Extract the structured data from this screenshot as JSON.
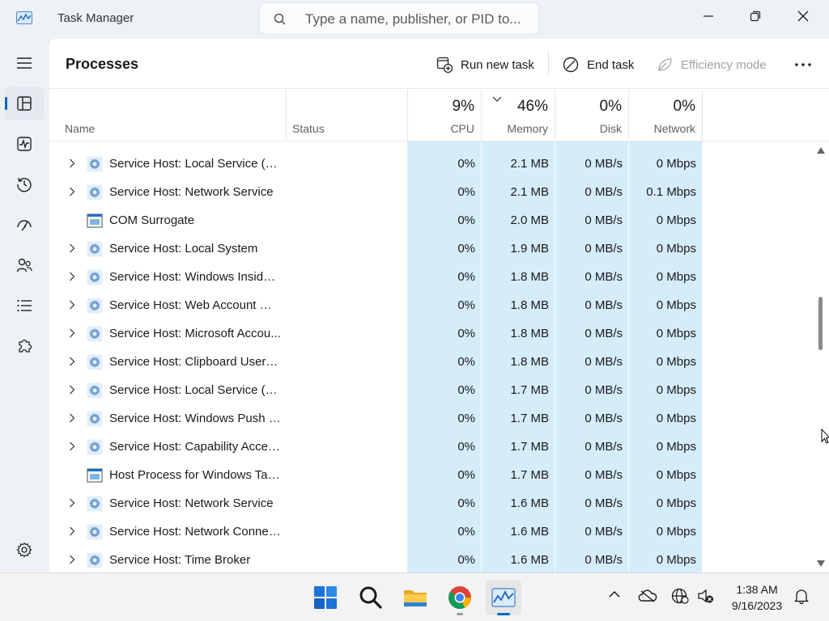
{
  "window": {
    "title": "Task Manager",
    "search_placeholder": "Type a name, publisher, or PID to..."
  },
  "toolbar": {
    "title": "Processes",
    "run_new_task": "Run new task",
    "end_task": "End task",
    "efficiency_mode": "Efficiency mode"
  },
  "columns": {
    "name": "Name",
    "status": "Status",
    "cpu": {
      "value": "9%",
      "label": "CPU"
    },
    "memory": {
      "value": "46%",
      "label": "Memory"
    },
    "disk": {
      "value": "0%",
      "label": "Disk"
    },
    "network": {
      "value": "0%",
      "label": "Network"
    }
  },
  "rows": [
    {
      "name": "Service Host: Local Service (N...",
      "cpu": "0%",
      "memory": "2.1 MB",
      "disk": "0 MB/s",
      "network": "0 Mbps",
      "expandable": true,
      "icon": "gear-icon"
    },
    {
      "name": "Service Host: Network Service",
      "cpu": "0%",
      "memory": "2.1 MB",
      "disk": "0 MB/s",
      "network": "0.1 Mbps",
      "expandable": true,
      "icon": "gear-icon"
    },
    {
      "name": "COM Surrogate",
      "cpu": "0%",
      "memory": "2.0 MB",
      "disk": "0 MB/s",
      "network": "0 Mbps",
      "expandable": false,
      "icon": "window-app-icon"
    },
    {
      "name": "Service Host: Local System",
      "cpu": "0%",
      "memory": "1.9 MB",
      "disk": "0 MB/s",
      "network": "0 Mbps",
      "expandable": true,
      "icon": "gear-icon"
    },
    {
      "name": "Service Host: Windows Insider ...",
      "cpu": "0%",
      "memory": "1.8 MB",
      "disk": "0 MB/s",
      "network": "0 Mbps",
      "expandable": true,
      "icon": "gear-icon"
    },
    {
      "name": "Service Host: Web Account Ma...",
      "cpu": "0%",
      "memory": "1.8 MB",
      "disk": "0 MB/s",
      "network": "0 Mbps",
      "expandable": true,
      "icon": "gear-icon"
    },
    {
      "name": "Service Host: Microsoft Accou...",
      "cpu": "0%",
      "memory": "1.8 MB",
      "disk": "0 MB/s",
      "network": "0 Mbps",
      "expandable": true,
      "icon": "gear-icon"
    },
    {
      "name": "Service Host: Clipboard User S...",
      "cpu": "0%",
      "memory": "1.8 MB",
      "disk": "0 MB/s",
      "network": "0 Mbps",
      "expandable": true,
      "icon": "gear-icon"
    },
    {
      "name": "Service Host: Local Service (N...",
      "cpu": "0%",
      "memory": "1.7 MB",
      "disk": "0 MB/s",
      "network": "0 Mbps",
      "expandable": true,
      "icon": "gear-icon"
    },
    {
      "name": "Service Host: Windows Push N...",
      "cpu": "0%",
      "memory": "1.7 MB",
      "disk": "0 MB/s",
      "network": "0 Mbps",
      "expandable": true,
      "icon": "gear-icon"
    },
    {
      "name": "Service Host: Capability Acces...",
      "cpu": "0%",
      "memory": "1.7 MB",
      "disk": "0 MB/s",
      "network": "0 Mbps",
      "expandable": true,
      "icon": "gear-icon"
    },
    {
      "name": "Host Process for Windows Tasks",
      "cpu": "0%",
      "memory": "1.7 MB",
      "disk": "0 MB/s",
      "network": "0 Mbps",
      "expandable": false,
      "icon": "window-app-icon"
    },
    {
      "name": "Service Host: Network Service",
      "cpu": "0%",
      "memory": "1.6 MB",
      "disk": "0 MB/s",
      "network": "0 Mbps",
      "expandable": true,
      "icon": "gear-icon"
    },
    {
      "name": "Service Host: Network Connec...",
      "cpu": "0%",
      "memory": "1.6 MB",
      "disk": "0 MB/s",
      "network": "0 Mbps",
      "expandable": true,
      "icon": "gear-icon"
    },
    {
      "name": "Service Host: Time Broker",
      "cpu": "0%",
      "memory": "1.6 MB",
      "disk": "0 MB/s",
      "network": "0 Mbps",
      "expandable": true,
      "icon": "gear-icon"
    }
  ],
  "taskbar": {
    "time": "1:38 AM",
    "date": "9/16/2023"
  },
  "colors": {
    "accent": "#0067c0",
    "highlight": "#d5ecfb"
  }
}
